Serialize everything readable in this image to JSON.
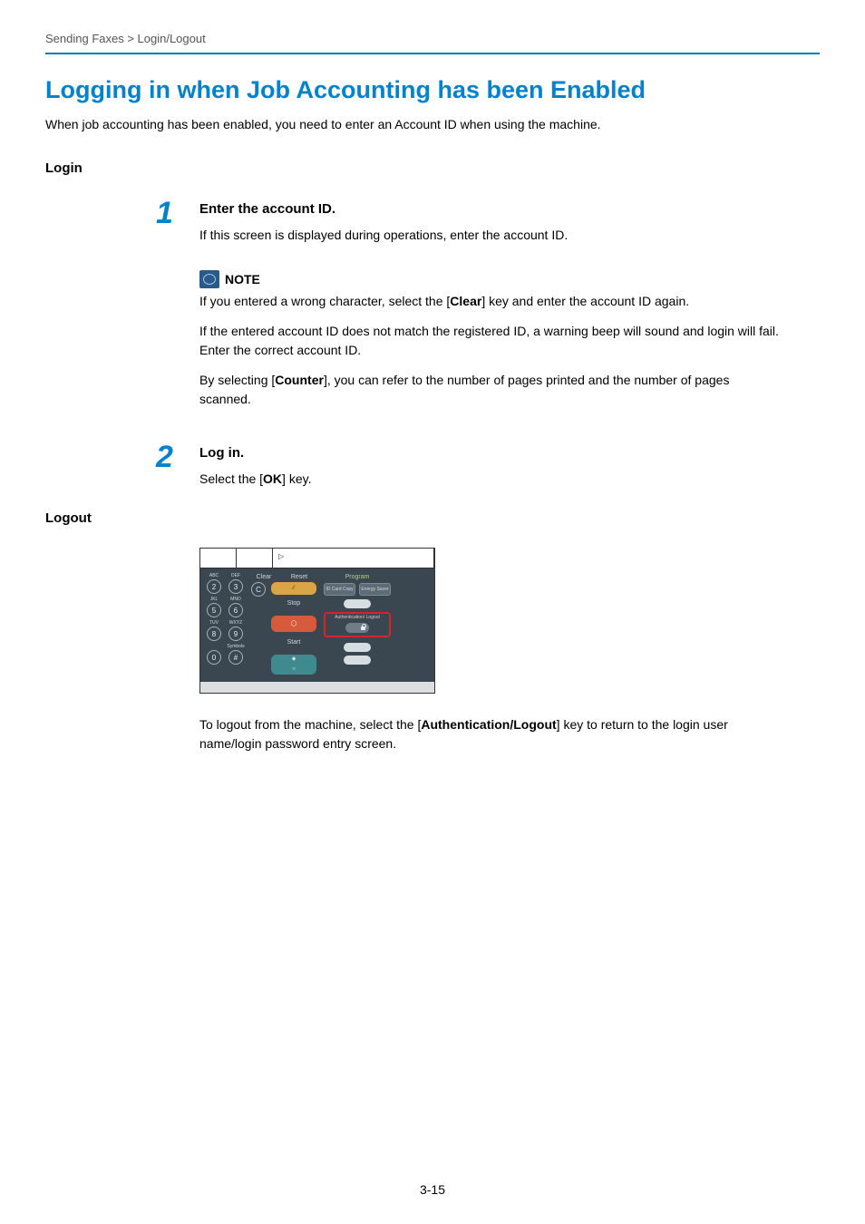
{
  "breadcrumb": "Sending Faxes > Login/Logout",
  "title": "Logging in when Job Accounting has been Enabled",
  "intro": "When job accounting has been enabled, you need to enter an Account ID when using the machine.",
  "login_heading": "Login",
  "logout_heading": "Logout",
  "step1": {
    "num": "1",
    "heading": "Enter the account ID.",
    "text": "If this screen is displayed during operations, enter the account ID."
  },
  "note": {
    "label": "NOTE",
    "p1_a": "If you entered a wrong character, select the [",
    "p1_b": "Clear",
    "p1_c": "] key and enter the account ID again.",
    "p2": "If the entered account ID does not match the registered ID, a warning beep will sound and login will fail. Enter the correct account ID.",
    "p3_a": "By selecting [",
    "p3_b": "Counter",
    "p3_c": "], you can refer to the number of pages printed and the number of pages scanned."
  },
  "step2": {
    "num": "2",
    "heading": "Log in.",
    "text_a": "Select the [",
    "text_b": "OK",
    "text_c": "] key."
  },
  "panel": {
    "keypad": {
      "abc": "ABC",
      "def": "DEF",
      "jkl": "JKL",
      "mno": "MNO",
      "tuv": "TUV",
      "wxyz": "WXYZ",
      "sym": "Symbols",
      "k2": "2",
      "k3": "3",
      "kc": "C",
      "k5": "5",
      "k6": "6",
      "k8": "8",
      "k9": "9",
      "k0": "0",
      "kh": "#"
    },
    "ctrl": {
      "clear": "Clear",
      "reset": "Reset",
      "stop": "Stop",
      "start": "Start"
    },
    "program": "Program",
    "idcard": "ID Card Copy",
    "energy": "Energy Saver",
    "auth": "Authentication/\nLogout"
  },
  "logout_text_a": "To logout from the machine, select the [",
  "logout_text_b": "Authentication/Logout",
  "logout_text_c": "] key to return to the login user name/login password entry screen.",
  "page_num": "3-15"
}
